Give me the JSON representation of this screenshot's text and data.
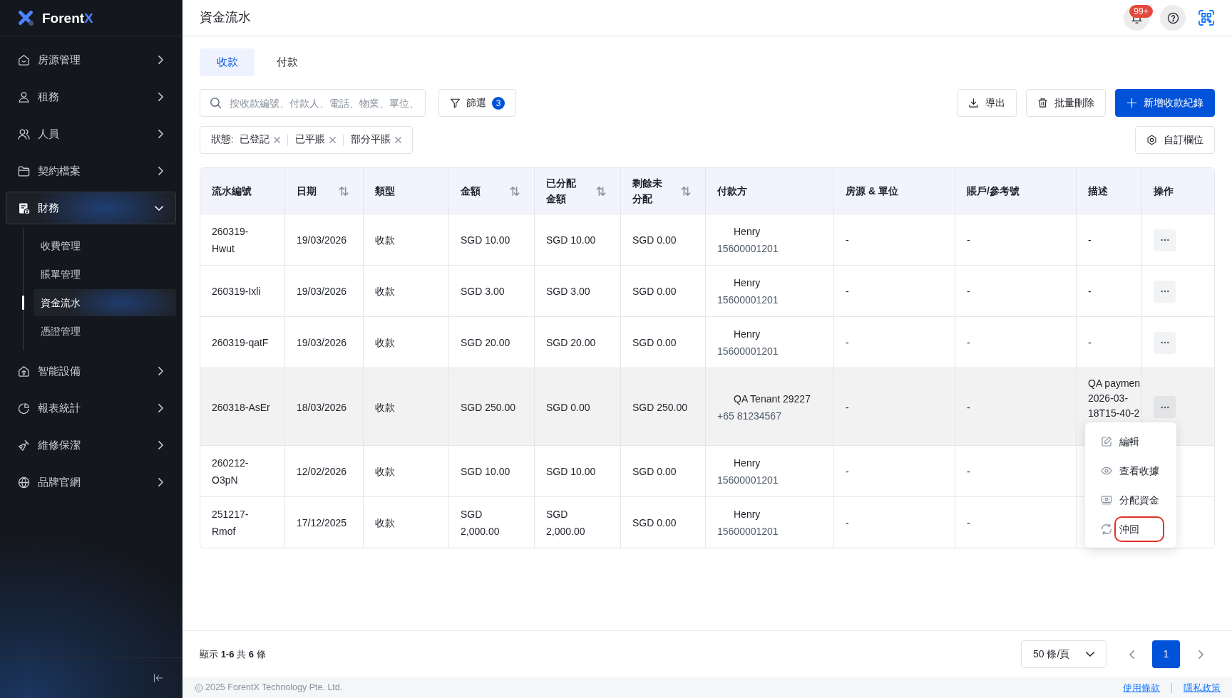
{
  "sidebar": {
    "brand": {
      "text": "Forent",
      "accent": "X"
    },
    "items": [
      {
        "label": "房源管理",
        "expanded": false,
        "selected": false
      },
      {
        "label": "租務",
        "expanded": false,
        "selected": false
      },
      {
        "label": "人員",
        "expanded": false,
        "selected": false
      },
      {
        "label": "契約檔案",
        "expanded": false,
        "selected": false
      },
      {
        "label": "財務",
        "expanded": true,
        "selected": true,
        "children": [
          {
            "label": "收費管理",
            "selected": false
          },
          {
            "label": "賬單管理",
            "selected": false
          },
          {
            "label": "資金流水",
            "selected": true
          },
          {
            "label": "憑證管理",
            "selected": false
          }
        ]
      },
      {
        "label": "智能設備",
        "expanded": false,
        "selected": false
      },
      {
        "label": "報表統計",
        "expanded": false,
        "selected": false
      },
      {
        "label": "維修保潔",
        "expanded": false,
        "selected": false
      },
      {
        "label": "品牌官網",
        "expanded": false,
        "selected": false
      }
    ]
  },
  "header": {
    "title": "資金流水",
    "notification_count": "99+"
  },
  "tabs": [
    {
      "label": "收款",
      "selected": true
    },
    {
      "label": "付款",
      "selected": false
    }
  ],
  "toolbar": {
    "search": {
      "placeholder": "按收款編號、付款人、電話、物業、單位、"
    },
    "filter": {
      "label": "篩選",
      "count": "3"
    },
    "actions": [
      {
        "label": "導出",
        "kind": "secondary"
      },
      {
        "label": "批量刪除",
        "kind": "secondary"
      },
      {
        "label": "新增收款紀錄",
        "kind": "primary"
      }
    ]
  },
  "active_filters": {
    "label": "狀態:",
    "values": [
      "已登記",
      "已平賬",
      "部分平賬"
    ]
  },
  "customize_columns": {
    "label": "自訂欄位"
  },
  "table": {
    "columns": [
      {
        "label": "流水編號",
        "sortable": false
      },
      {
        "label": "日期",
        "sortable": true
      },
      {
        "label": "類型",
        "sortable": false
      },
      {
        "label": "金額",
        "sortable": true
      },
      {
        "label": "已分配金額",
        "sortable": true
      },
      {
        "label": "剩餘未分配",
        "sortable": true
      },
      {
        "label": "付款方",
        "sortable": false
      },
      {
        "label": "房源 & 單位",
        "sortable": false
      },
      {
        "label": "賬戶/參考號",
        "sortable": false
      },
      {
        "label": "描述",
        "sortable": false
      },
      {
        "label": "操作",
        "sortable": false
      }
    ],
    "rows": [
      {
        "id": "260319-Hwut",
        "date": "19/03/2026",
        "type": "收款",
        "amount": "SGD 10.00",
        "allocated": "SGD 10.00",
        "remaining": "SGD 0.00",
        "payer": {
          "name": "Henry",
          "phone": "15600001201"
        },
        "property": "-",
        "account": "-",
        "description": [
          "-"
        ],
        "menu_open": false
      },
      {
        "id": "260319-Ixli",
        "date": "19/03/2026",
        "type": "收款",
        "amount": "SGD 3.00",
        "allocated": "SGD 3.00",
        "remaining": "SGD 0.00",
        "payer": {
          "name": "Henry",
          "phone": "15600001201"
        },
        "property": "-",
        "account": "-",
        "description": [
          "-"
        ],
        "menu_open": false
      },
      {
        "id": "260319-qatF",
        "date": "19/03/2026",
        "type": "收款",
        "amount": "SGD 20.00",
        "allocated": "SGD 20.00",
        "remaining": "SGD 0.00",
        "payer": {
          "name": "Henry",
          "phone": "15600001201"
        },
        "property": "-",
        "account": "-",
        "description": [
          "-"
        ],
        "menu_open": false
      },
      {
        "id": "260318-AsEr",
        "date": "18/03/2026",
        "type": "收款",
        "amount": "SGD 250.00",
        "allocated": "SGD 0.00",
        "remaining": "SGD 250.00",
        "payer": {
          "name": "QA Tenant 29227",
          "phone": "+65 81234567"
        },
        "property": "-",
        "account": "-",
        "description": [
          "QA paymen",
          "2026-03-",
          "18T15-40-2"
        ],
        "menu_open": true
      },
      {
        "id": "260212-O3pN",
        "date": "12/02/2026",
        "type": "收款",
        "amount": "SGD 10.00",
        "allocated": "SGD 10.00",
        "remaining": "SGD 0.00",
        "payer": {
          "name": "Henry",
          "phone": "15600001201"
        },
        "property": "-",
        "account": "-",
        "description": [],
        "menu_open": false
      },
      {
        "id": "251217-Rmof",
        "date": "17/12/2025",
        "type": "收款",
        "amount": "SGD 2,000.00",
        "allocated": "SGD 2,000.00",
        "remaining": "SGD 0.00",
        "payer": {
          "name": "Henry",
          "phone": "15600001201"
        },
        "property": "-",
        "account": "-",
        "description": [],
        "menu_open": false
      }
    ],
    "row_menu": [
      {
        "label": "編輯",
        "highlighted": false
      },
      {
        "label": "查看收據",
        "highlighted": false
      },
      {
        "label": "分配資金",
        "highlighted": false
      },
      {
        "label": "沖回",
        "highlighted": true
      }
    ]
  },
  "pagination": {
    "summary": "顯示 **1-6** 共 **6** 條",
    "page_size": "50 條/頁",
    "pages": [
      {
        "label": "1",
        "selected": true
      }
    ]
  },
  "footer": {
    "copyright": "2025 ForentX Technology Pte. Ltd.",
    "links": [
      "使用條款",
      "隱私政策"
    ]
  }
}
